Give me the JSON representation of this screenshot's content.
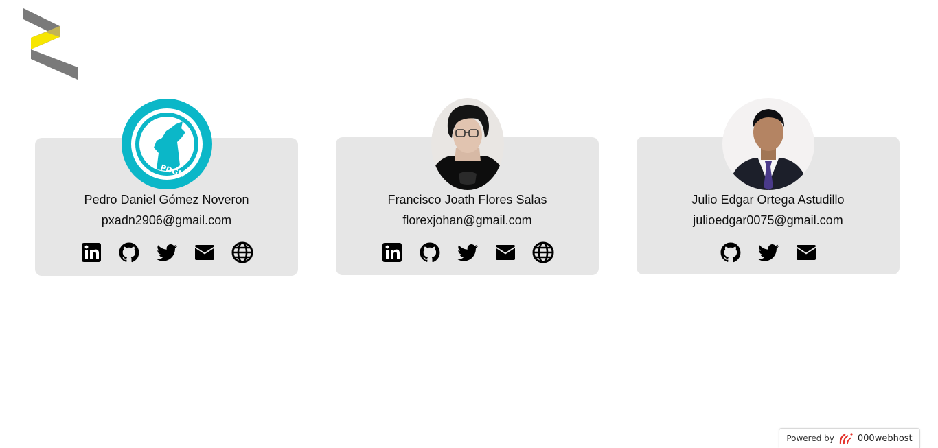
{
  "colors": {
    "card_bg": "#e6e6e6",
    "logo_gray": "#7a7a7a",
    "logo_yellow": "#f7e600",
    "logo_olive": "#c2b356",
    "pdgn_teal": "#0bb7c8",
    "icon": "#000000",
    "webhost_red": "#e3322b"
  },
  "logo": {
    "icon": "zigzag-logo"
  },
  "team": [
    {
      "name": "Pedro Daniel Gómez Noveron",
      "email": "pxadn2906@gmail.com",
      "avatar_text": "PDGN",
      "socials": [
        "linkedin-icon",
        "github-icon",
        "twitter-icon",
        "email-icon",
        "globe-icon"
      ]
    },
    {
      "name": "Francisco Joath Flores Salas",
      "email": "florexjohan@gmail.com",
      "socials": [
        "linkedin-icon",
        "github-icon",
        "twitter-icon",
        "email-icon",
        "globe-icon"
      ]
    },
    {
      "name": "Julio Edgar Ortega Astudillo",
      "email": "julioedgar0075@gmail.com",
      "socials": [
        "github-icon",
        "twitter-icon",
        "email-icon"
      ]
    }
  ],
  "footer": {
    "powered_by": "Powered by",
    "brand": "000webhost"
  }
}
